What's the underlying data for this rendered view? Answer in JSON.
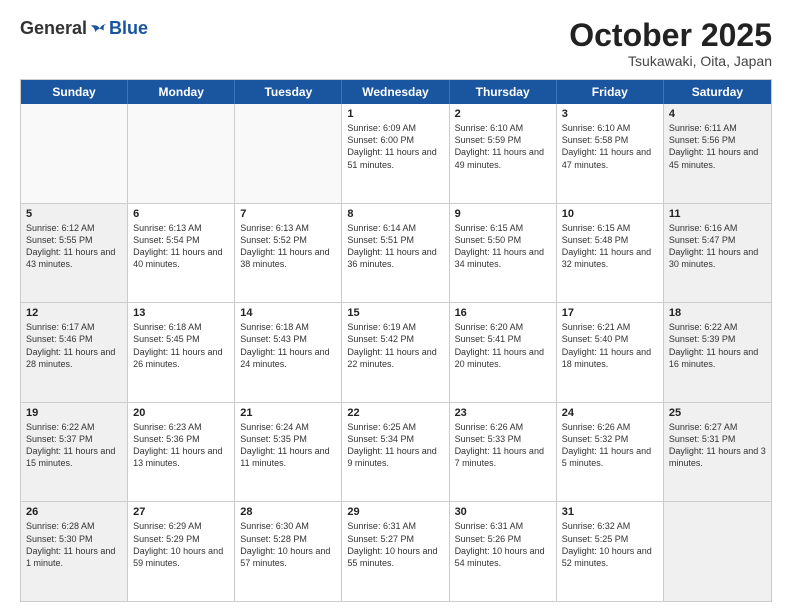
{
  "header": {
    "logo_general": "General",
    "logo_blue": "Blue",
    "month_title": "October 2025",
    "subtitle": "Tsukawaki, Oita, Japan"
  },
  "weekdays": [
    "Sunday",
    "Monday",
    "Tuesday",
    "Wednesday",
    "Thursday",
    "Friday",
    "Saturday"
  ],
  "weeks": [
    [
      {
        "day": "",
        "text": "",
        "empty": true
      },
      {
        "day": "",
        "text": "",
        "empty": true
      },
      {
        "day": "",
        "text": "",
        "empty": true
      },
      {
        "day": "1",
        "text": "Sunrise: 6:09 AM\nSunset: 6:00 PM\nDaylight: 11 hours\nand 51 minutes.",
        "empty": false
      },
      {
        "day": "2",
        "text": "Sunrise: 6:10 AM\nSunset: 5:59 PM\nDaylight: 11 hours\nand 49 minutes.",
        "empty": false
      },
      {
        "day": "3",
        "text": "Sunrise: 6:10 AM\nSunset: 5:58 PM\nDaylight: 11 hours\nand 47 minutes.",
        "empty": false
      },
      {
        "day": "4",
        "text": "Sunrise: 6:11 AM\nSunset: 5:56 PM\nDaylight: 11 hours\nand 45 minutes.",
        "empty": false,
        "shaded": true
      }
    ],
    [
      {
        "day": "5",
        "text": "Sunrise: 6:12 AM\nSunset: 5:55 PM\nDaylight: 11 hours\nand 43 minutes.",
        "empty": false,
        "shaded": true
      },
      {
        "day": "6",
        "text": "Sunrise: 6:13 AM\nSunset: 5:54 PM\nDaylight: 11 hours\nand 40 minutes.",
        "empty": false
      },
      {
        "day": "7",
        "text": "Sunrise: 6:13 AM\nSunset: 5:52 PM\nDaylight: 11 hours\nand 38 minutes.",
        "empty": false
      },
      {
        "day": "8",
        "text": "Sunrise: 6:14 AM\nSunset: 5:51 PM\nDaylight: 11 hours\nand 36 minutes.",
        "empty": false
      },
      {
        "day": "9",
        "text": "Sunrise: 6:15 AM\nSunset: 5:50 PM\nDaylight: 11 hours\nand 34 minutes.",
        "empty": false
      },
      {
        "day": "10",
        "text": "Sunrise: 6:15 AM\nSunset: 5:48 PM\nDaylight: 11 hours\nand 32 minutes.",
        "empty": false
      },
      {
        "day": "11",
        "text": "Sunrise: 6:16 AM\nSunset: 5:47 PM\nDaylight: 11 hours\nand 30 minutes.",
        "empty": false,
        "shaded": true
      }
    ],
    [
      {
        "day": "12",
        "text": "Sunrise: 6:17 AM\nSunset: 5:46 PM\nDaylight: 11 hours\nand 28 minutes.",
        "empty": false,
        "shaded": true
      },
      {
        "day": "13",
        "text": "Sunrise: 6:18 AM\nSunset: 5:45 PM\nDaylight: 11 hours\nand 26 minutes.",
        "empty": false
      },
      {
        "day": "14",
        "text": "Sunrise: 6:18 AM\nSunset: 5:43 PM\nDaylight: 11 hours\nand 24 minutes.",
        "empty": false
      },
      {
        "day": "15",
        "text": "Sunrise: 6:19 AM\nSunset: 5:42 PM\nDaylight: 11 hours\nand 22 minutes.",
        "empty": false
      },
      {
        "day": "16",
        "text": "Sunrise: 6:20 AM\nSunset: 5:41 PM\nDaylight: 11 hours\nand 20 minutes.",
        "empty": false
      },
      {
        "day": "17",
        "text": "Sunrise: 6:21 AM\nSunset: 5:40 PM\nDaylight: 11 hours\nand 18 minutes.",
        "empty": false
      },
      {
        "day": "18",
        "text": "Sunrise: 6:22 AM\nSunset: 5:39 PM\nDaylight: 11 hours\nand 16 minutes.",
        "empty": false,
        "shaded": true
      }
    ],
    [
      {
        "day": "19",
        "text": "Sunrise: 6:22 AM\nSunset: 5:37 PM\nDaylight: 11 hours\nand 15 minutes.",
        "empty": false,
        "shaded": true
      },
      {
        "day": "20",
        "text": "Sunrise: 6:23 AM\nSunset: 5:36 PM\nDaylight: 11 hours\nand 13 minutes.",
        "empty": false
      },
      {
        "day": "21",
        "text": "Sunrise: 6:24 AM\nSunset: 5:35 PM\nDaylight: 11 hours\nand 11 minutes.",
        "empty": false
      },
      {
        "day": "22",
        "text": "Sunrise: 6:25 AM\nSunset: 5:34 PM\nDaylight: 11 hours\nand 9 minutes.",
        "empty": false
      },
      {
        "day": "23",
        "text": "Sunrise: 6:26 AM\nSunset: 5:33 PM\nDaylight: 11 hours\nand 7 minutes.",
        "empty": false
      },
      {
        "day": "24",
        "text": "Sunrise: 6:26 AM\nSunset: 5:32 PM\nDaylight: 11 hours\nand 5 minutes.",
        "empty": false
      },
      {
        "day": "25",
        "text": "Sunrise: 6:27 AM\nSunset: 5:31 PM\nDaylight: 11 hours\nand 3 minutes.",
        "empty": false,
        "shaded": true
      }
    ],
    [
      {
        "day": "26",
        "text": "Sunrise: 6:28 AM\nSunset: 5:30 PM\nDaylight: 11 hours\nand 1 minute.",
        "empty": false,
        "shaded": true
      },
      {
        "day": "27",
        "text": "Sunrise: 6:29 AM\nSunset: 5:29 PM\nDaylight: 10 hours\nand 59 minutes.",
        "empty": false
      },
      {
        "day": "28",
        "text": "Sunrise: 6:30 AM\nSunset: 5:28 PM\nDaylight: 10 hours\nand 57 minutes.",
        "empty": false
      },
      {
        "day": "29",
        "text": "Sunrise: 6:31 AM\nSunset: 5:27 PM\nDaylight: 10 hours\nand 55 minutes.",
        "empty": false
      },
      {
        "day": "30",
        "text": "Sunrise: 6:31 AM\nSunset: 5:26 PM\nDaylight: 10 hours\nand 54 minutes.",
        "empty": false
      },
      {
        "day": "31",
        "text": "Sunrise: 6:32 AM\nSunset: 5:25 PM\nDaylight: 10 hours\nand 52 minutes.",
        "empty": false
      },
      {
        "day": "",
        "text": "",
        "empty": true,
        "shaded": true
      }
    ]
  ]
}
